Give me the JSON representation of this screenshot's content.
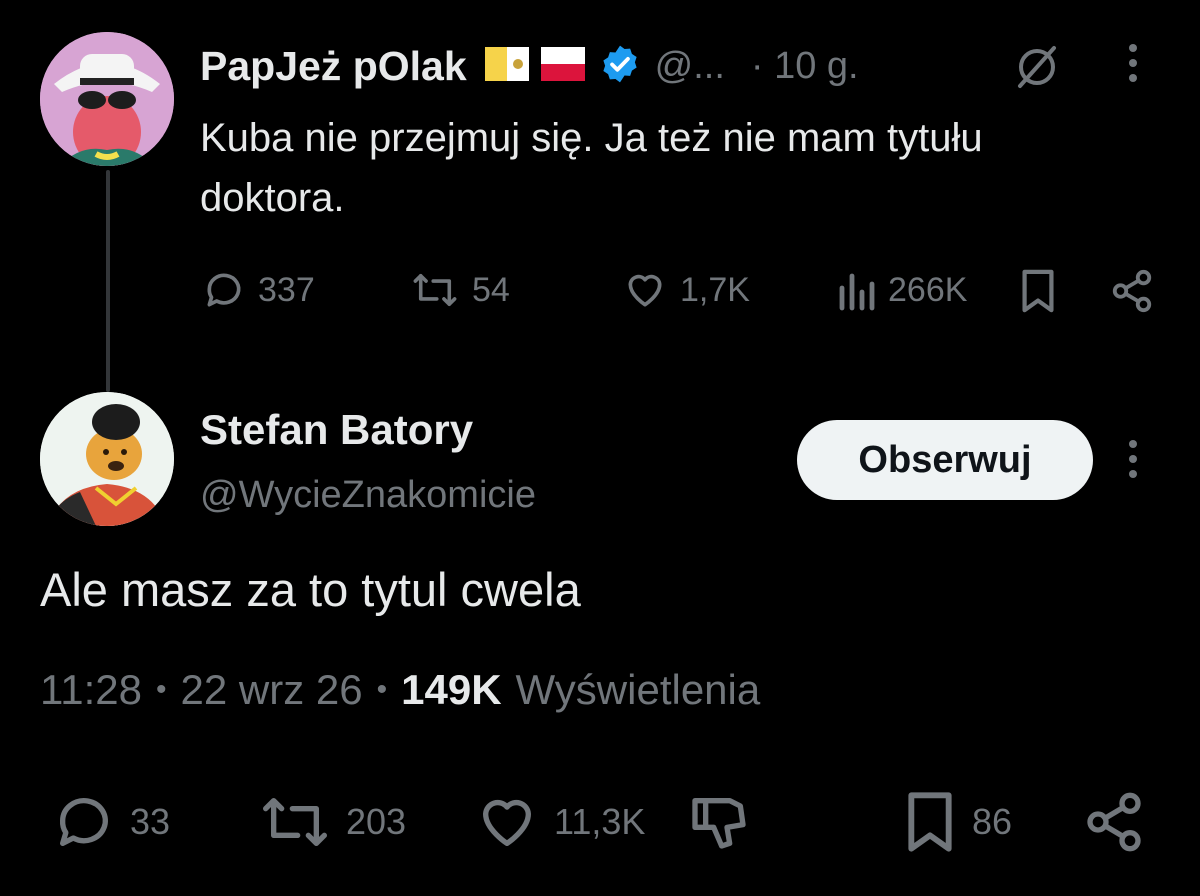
{
  "parent_tweet": {
    "display_name": "PapJeż pOlak",
    "handle": "@...",
    "time": "· 10 g.",
    "text": "Kuba nie przejmuj się. Ja też nie mam tytułu doktora.",
    "stats": {
      "replies": "337",
      "retweets": "54",
      "likes": "1,7K",
      "views": "266K"
    }
  },
  "reply_tweet": {
    "display_name": "Stefan Batory",
    "handle": "@WycieZnakomicie",
    "follow_label": "Obserwuj",
    "text": "Ale masz za to tytul cwela",
    "meta": {
      "time": "11:28",
      "sep1": "•",
      "date": "22 wrz 26",
      "sep2": "•",
      "views_count": "149K",
      "views_label": "Wyświetlenia"
    },
    "stats": {
      "replies": "33",
      "retweets": "203",
      "likes": "11,3K",
      "bookmarks": "86"
    }
  },
  "colors": {
    "background": "#000000",
    "text": "#e7e9ea",
    "muted": "#71767b",
    "verified": "#1d9bf0",
    "follow_bg": "#eff3f4"
  }
}
